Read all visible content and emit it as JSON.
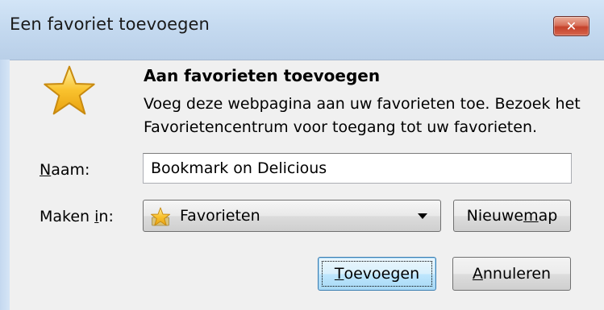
{
  "window": {
    "title": "Een favoriet toevoegen",
    "close_glyph": "✕"
  },
  "main": {
    "heading": "Aan favorieten toevoegen",
    "description_line1": "Voeg deze webpagina aan uw favorieten toe. Bezoek het",
    "description_line2": "Favorietencentrum voor toegang tot uw favorieten.",
    "icon": "star-icon"
  },
  "form": {
    "name_label_accel": "N",
    "name_label_rest": "aam:",
    "name_value": "Bookmark on Delicious",
    "create_in_label_pre": "Maken ",
    "create_in_label_accel": "i",
    "create_in_label_rest": "n:",
    "create_in_value": "Favorieten",
    "create_in_icon": "star-folder-icon"
  },
  "buttons": {
    "new_folder_pre": "Nieuwe ",
    "new_folder_accel": "m",
    "new_folder_rest": "ap",
    "add_accel": "T",
    "add_rest": "oevoegen",
    "cancel_accel": "A",
    "cancel_rest": "nnuleren"
  },
  "colors": {
    "titlebar": "#c5daf0",
    "close_button": "#c5422b",
    "dialog_background": "#f0f0f0",
    "default_button_border": "#3c7fb1",
    "star_fill": "#f9c22e"
  }
}
